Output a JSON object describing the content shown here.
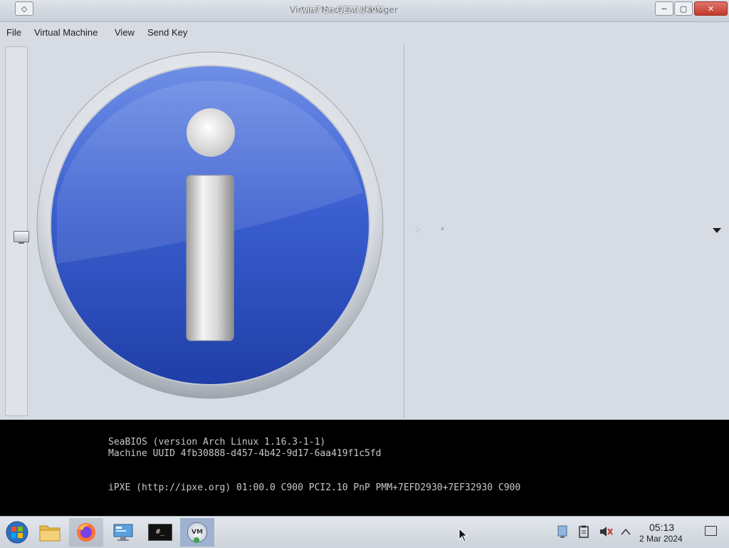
{
  "window": {
    "title": "win7 on QEMU/KVM",
    "title_behind": "Virtual Machine Manager",
    "menu_icon": "diamond-menu-icon",
    "minimize": "−",
    "maximize": "▢",
    "close": "✕"
  },
  "menubar": {
    "items": [
      "File",
      "Virtual Machine",
      "View",
      "Send Key"
    ]
  },
  "toolbar": {
    "details_icon": "monitor-icon",
    "play_icon": "▷",
    "pause_icon": "⏸",
    "dropdown_icon": "chevron-down-icon"
  },
  "console": {
    "lines": [
      "SeaBIOS (version Arch Linux 1.16.3-1-1)",
      "Machine UUID 4fb30888-d457-4b42-9d17-6aa419f1c5fd",
      "iPXE (http://ipxe.org) 01:00.0 C900 PCI2.10 PnP PMM+7EFD2930+7EF32930 C900"
    ]
  },
  "taskbar": {
    "apps": [
      {
        "name": "start-orb-icon"
      },
      {
        "name": "file-explorer-icon"
      },
      {
        "name": "firefox-icon"
      },
      {
        "name": "remote-desktop-icon"
      },
      {
        "name": "terminal-icon",
        "text": "#_"
      },
      {
        "name": "virt-manager-icon",
        "text": "VM"
      }
    ],
    "tray": [
      "network-icon",
      "clipboard-icon",
      "volume-muted-icon",
      "chevron-up-icon"
    ],
    "clock": {
      "time": "05:13",
      "date": "2 Mar 2024"
    }
  },
  "colors": {
    "background": "#d6dbe4",
    "info_blue": "#3b57c8",
    "console_bg": "#000000",
    "console_text": "#c8c8c8"
  }
}
